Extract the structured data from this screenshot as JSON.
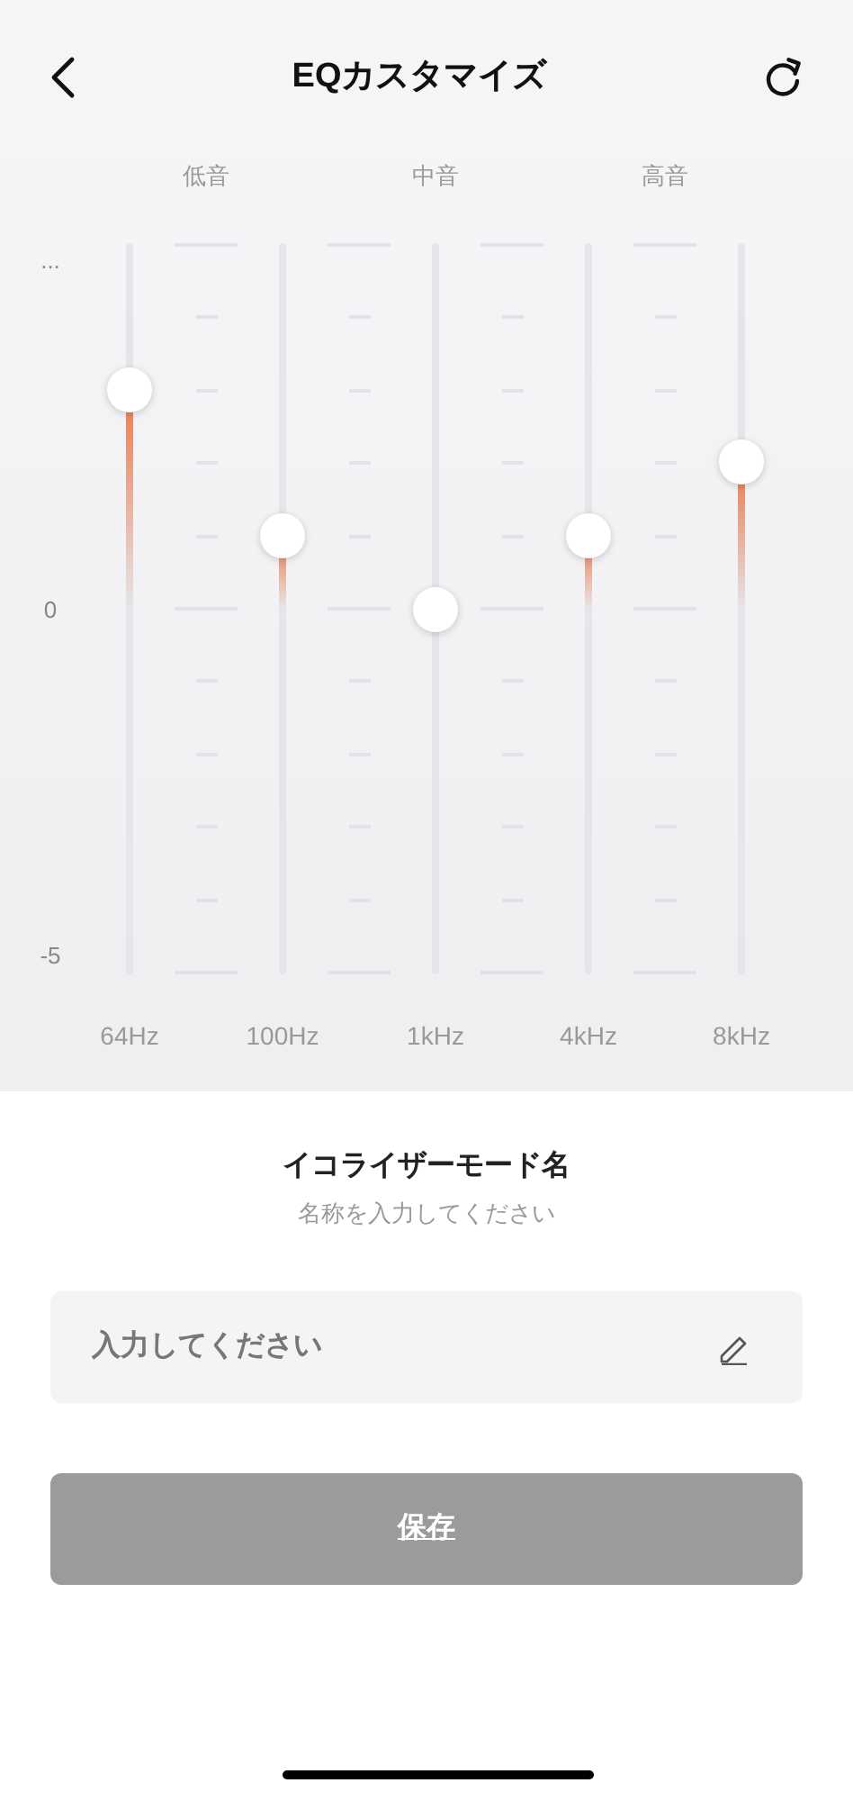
{
  "header": {
    "title": "EQカスタマイズ"
  },
  "groups": [
    "低音",
    "中音",
    "高音"
  ],
  "axis_labels": [
    "...",
    "0",
    "-5"
  ],
  "bands": [
    {
      "label": "64Hz",
      "level": 0.8
    },
    {
      "label": "100Hz",
      "level": 0.6
    },
    {
      "label": "1kHz",
      "level": 0.5
    },
    {
      "label": "4kHz",
      "level": 0.6
    },
    {
      "label": "8kHz",
      "level": 0.7
    }
  ],
  "name_section": {
    "title": "イコライザーモード名",
    "subtitle": "名称を入力してください",
    "field": {
      "placeholder": "入力してください"
    }
  },
  "save_button": {
    "label": "保存",
    "disabled": true
  }
}
